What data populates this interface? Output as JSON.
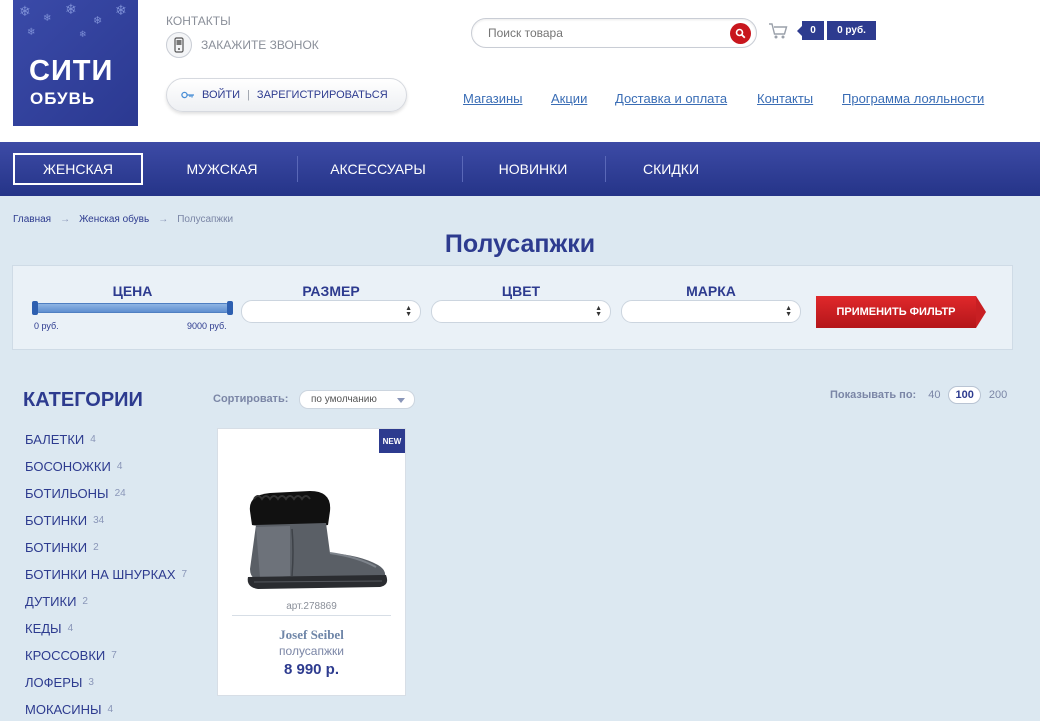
{
  "logo": {
    "line1": "СИТИ",
    "line2": "ОБУВЬ"
  },
  "header": {
    "contacts_label": "КОНТАКТЫ",
    "call_label": "ЗАКАЖИТЕ ЗВОНОК",
    "login_label": "ВОЙТИ",
    "login_sep": "|",
    "register_label": "ЗАРЕГИСТРИРОВАТЬСЯ",
    "search_placeholder": "Поиск товара",
    "cart_count": "0",
    "cart_sum": "0 руб.",
    "links": [
      "Магазины",
      "Акции",
      "Доставка и оплата",
      "Контакты",
      "Программа лояльности"
    ]
  },
  "nav": {
    "items": [
      "ЖЕНСКАЯ",
      "МУЖСКАЯ",
      "АКСЕССУАРЫ",
      "НОВИНКИ",
      "СКИДКИ"
    ],
    "active": "ЖЕНСКАЯ"
  },
  "breadcrumb": {
    "home": "Главная",
    "arrow": "→",
    "section": "Женская обувь",
    "current": "Полусапжки"
  },
  "page_title": "Полусапжки",
  "filter": {
    "price_label": "ЦЕНА",
    "price_min_label": "0 руб.",
    "price_max_label": "9000 руб.",
    "size_label": "РАЗМЕР",
    "color_label": "ЦВЕТ",
    "brand_label": "МАРКА",
    "apply_label": "ПРИМЕНИТЬ ФИЛЬТР"
  },
  "categories": {
    "title": "КАТЕГОРИИ",
    "items": [
      {
        "name": "БАЛЕТКИ",
        "count": "4"
      },
      {
        "name": "БОСОНОЖКИ",
        "count": "4"
      },
      {
        "name": "БОТИЛЬОНЫ",
        "count": "24"
      },
      {
        "name": "БОТИНКИ",
        "count": "34"
      },
      {
        "name": "БОТИНКИ",
        "count": "2"
      },
      {
        "name": "БОТИНКИ НА ШНУРКАХ",
        "count": "7"
      },
      {
        "name": "ДУТИКИ",
        "count": "2"
      },
      {
        "name": "КЕДЫ",
        "count": "4"
      },
      {
        "name": "КРОССОВКИ",
        "count": "7"
      },
      {
        "name": "ЛОФЕРЫ",
        "count": "3"
      },
      {
        "name": "МОКАСИНЫ",
        "count": "4"
      }
    ]
  },
  "sort": {
    "label": "Сортировать:",
    "value": "по умолчанию"
  },
  "show_by": {
    "label": "Показывать по:",
    "options": [
      "40",
      "100",
      "200"
    ],
    "selected": "100"
  },
  "product": {
    "badge": "NEW",
    "sku": "арт.278869",
    "brand": "Josef Seibel",
    "type": "полусапжки",
    "price": "8 990 р."
  },
  "colors": {
    "brand_blue": "#2d3b8f",
    "accent_red": "#c8161d",
    "link_blue": "#3a6db5",
    "page_bg": "#dce8f1"
  }
}
